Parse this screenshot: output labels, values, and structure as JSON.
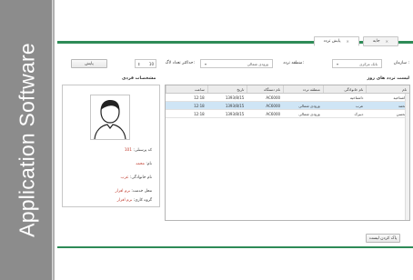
{
  "banner": {
    "text": "Application Software"
  },
  "tabs": [
    {
      "label": "جایه",
      "active": false
    },
    {
      "label": "پایش تردد",
      "active": true
    }
  ],
  "filters": {
    "org_label": "سازمان :",
    "org_value": "بانک مرکزی",
    "zone_label": "منطقه تردد:",
    "zone_value": "ورودی شمالی",
    "max_label": "حداکثر تعداد لاگ:",
    "max_value": "10",
    "search_button": "پایش"
  },
  "table": {
    "title": "لیست تردد های روز",
    "headers": [
      "نام",
      "نام خانوادگی",
      "منطقه تردد",
      "نام دستگاه",
      "تاریخ",
      "ساعت"
    ],
    "rows": [
      [
        "داشتاخیه",
        "داشتاخیه",
        "",
        "AC6000",
        "1393/8/15",
        "12:18"
      ],
      [
        "محمد",
        "عرب",
        "ورودی شمالی",
        "AC6000",
        "1393/8/15",
        "12:18"
      ],
      [
        "محسن",
        "دبیرک",
        "ورودی شمالی",
        "AC6000",
        "1393/8/15",
        "12:18"
      ]
    ],
    "selected_row": 1
  },
  "profile": {
    "title": "مشخصات فردی",
    "items": [
      {
        "label": "کد پرسنلی:",
        "value": "101"
      },
      {
        "label": "نام:",
        "value": "محمد"
      },
      {
        "label": "نام خانوادگی:",
        "value": "عرب"
      },
      {
        "label": "محل خدمت:",
        "value": "نرم افزار"
      },
      {
        "label": "گروه کاری:",
        "value": "نرم افزار"
      }
    ]
  },
  "footer": {
    "report_button": "پاک کردن لیست"
  }
}
